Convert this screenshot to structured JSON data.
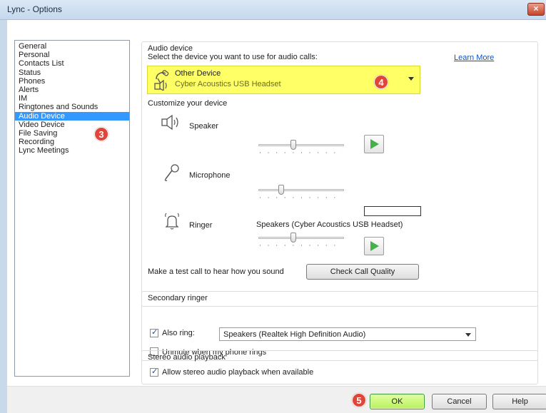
{
  "window": {
    "title": "Lync - Options",
    "close_label": "×"
  },
  "sidebar": {
    "items": [
      {
        "label": "General"
      },
      {
        "label": "Personal"
      },
      {
        "label": "Contacts List"
      },
      {
        "label": "Status"
      },
      {
        "label": "Phones"
      },
      {
        "label": "Alerts"
      },
      {
        "label": "IM"
      },
      {
        "label": "Ringtones and Sounds"
      },
      {
        "label": "Audio Device"
      },
      {
        "label": "Video Device"
      },
      {
        "label": "File Saving"
      },
      {
        "label": "Recording"
      },
      {
        "label": "Lync Meetings"
      }
    ],
    "selected": "Audio Device"
  },
  "badges": {
    "sidebar": "3",
    "device": "4",
    "ok": "5"
  },
  "audio": {
    "section_title": "Audio device",
    "prompt": "Select the device you want to use for audio calls:",
    "learn_more": "Learn More",
    "device_line1": "Other Device",
    "device_line2": "Cyber Acoustics USB Headset",
    "customize_title": "Customize your device",
    "speaker_label": "Speaker",
    "microphone_label": "Microphone",
    "ringer_label": "Ringer",
    "ringer_device": "Speakers (Cyber Acoustics USB Headset)",
    "speaker_level": 0.4,
    "microphone_level": 0.25,
    "ringer_level": 0.4,
    "test_call_text": "Make a test call to hear how you sound",
    "check_quality": "Check Call Quality"
  },
  "secondary": {
    "title": "Secondary ringer",
    "also_ring": "Also ring:",
    "also_ring_checked": true,
    "also_ring_device": "Speakers (Realtek High Definition Audio)",
    "unmute": "Unmute when my phone rings",
    "unmute_checked": false
  },
  "stereo": {
    "title": "Stereo audio playback",
    "allow": "Allow stereo audio playback when available",
    "allow_checked": true
  },
  "buttons": {
    "ok": "OK",
    "cancel": "Cancel",
    "help": "Help"
  },
  "colors": {
    "selection": "#3399ff",
    "highlight": "#ffff66",
    "ok_button": "#b7f15d",
    "badge": "#e0453a",
    "play": "#45b249"
  },
  "icons": [
    "headset-icon",
    "speaker-icon",
    "microphone-icon",
    "bell-icon",
    "play-icon",
    "checkmark-icon",
    "chevron-down-icon",
    "close-icon"
  ]
}
